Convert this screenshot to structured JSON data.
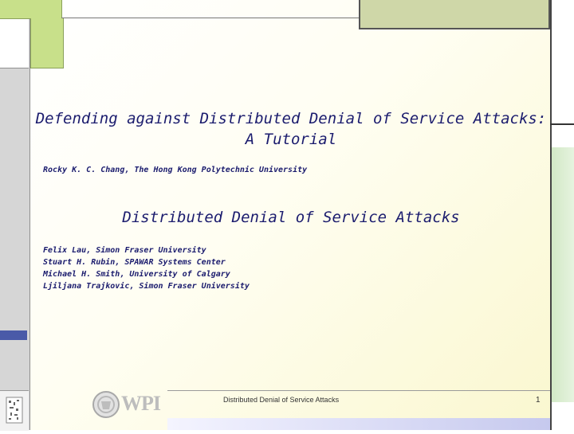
{
  "slide": {
    "title_line1": "Defending against Distributed Denial of Service Attacks:",
    "title_line2": "A Tutorial",
    "byline": "Rocky K. C. Chang, The Hong Kong Polytechnic University",
    "subtitle": "Distributed Denial of Service Attacks",
    "authors": [
      "Felix Lau, Simon Fraser University",
      "Stuart H. Rubin, SPAWAR Systems Center",
      "Michael H. Smith, University of Calgary",
      "Ljiljana Trajkovic, Simon Fraser University"
    ]
  },
  "footer": {
    "text": "Distributed Denial of Service Attacks",
    "page_number": "1",
    "logo_text": "WPI"
  },
  "colors": {
    "text": "#1b1c6e",
    "green_accent": "#c8e08a",
    "olive_accent": "#cfd7a8",
    "blue_marker": "#4a5aa8"
  }
}
